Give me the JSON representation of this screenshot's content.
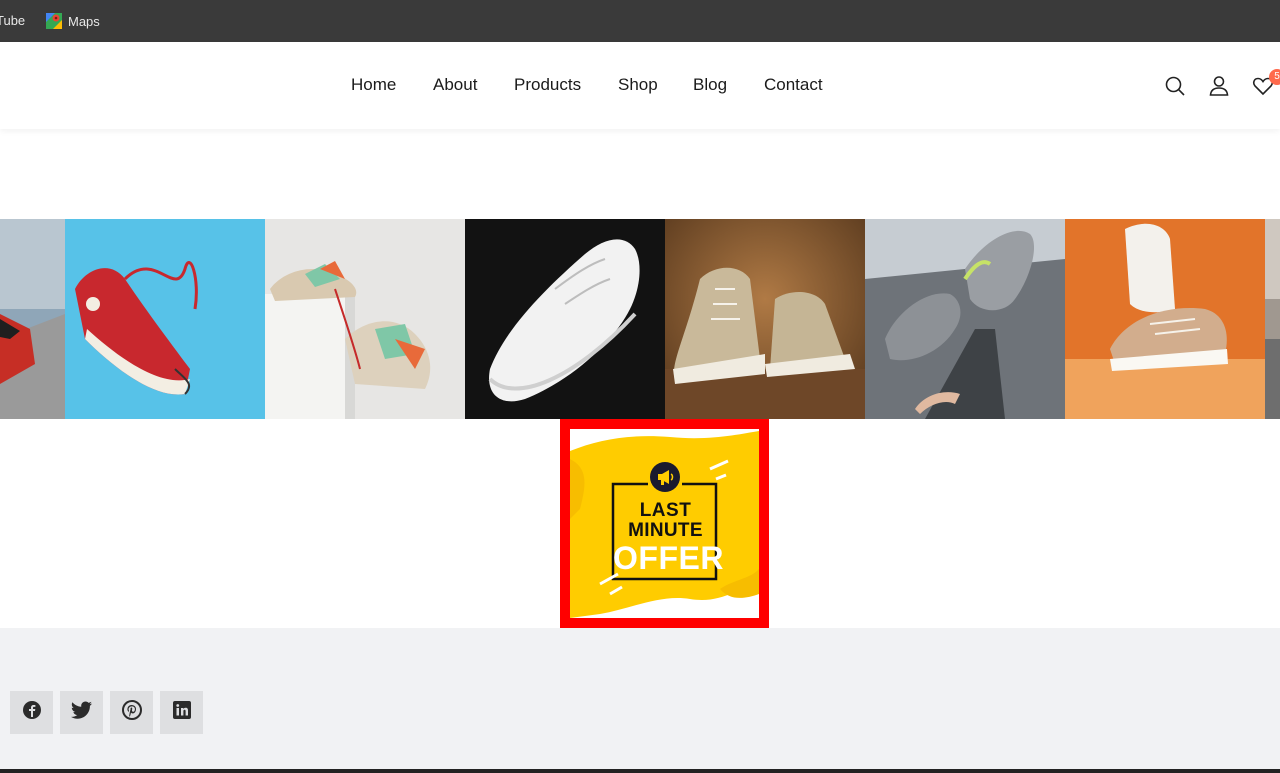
{
  "bookmarks": {
    "items": [
      {
        "label": "Tube",
        "icon": "youtube-icon"
      },
      {
        "label": "Maps",
        "icon": "google-maps-icon"
      }
    ]
  },
  "nav": {
    "items": [
      "Home",
      "About",
      "Products",
      "Shop",
      "Blog",
      "Contact"
    ]
  },
  "header": {
    "icons": [
      "search-icon",
      "user-icon",
      "heart-icon"
    ],
    "wishlist_count": "5"
  },
  "gallery": {
    "images": [
      "skateboard-shoe-photo",
      "red-high-top-sneaker-photo",
      "colorful-sneakers-on-box-photo",
      "white-sneaker-black-background-photo",
      "beige-high-tops-photo",
      "grey-knit-sneakers-photo",
      "white-beige-sneaker-orange-background-photo",
      "partial-photo"
    ]
  },
  "offer": {
    "line1": "LAST",
    "line2": "MINUTE",
    "line3": "OFFER",
    "icon": "megaphone-icon",
    "colors": {
      "border": "#ff0000",
      "background": "#ffcc00"
    }
  },
  "footer": {
    "social": [
      "facebook-icon",
      "twitter-icon",
      "pinterest-icon",
      "linkedin-icon"
    ]
  }
}
